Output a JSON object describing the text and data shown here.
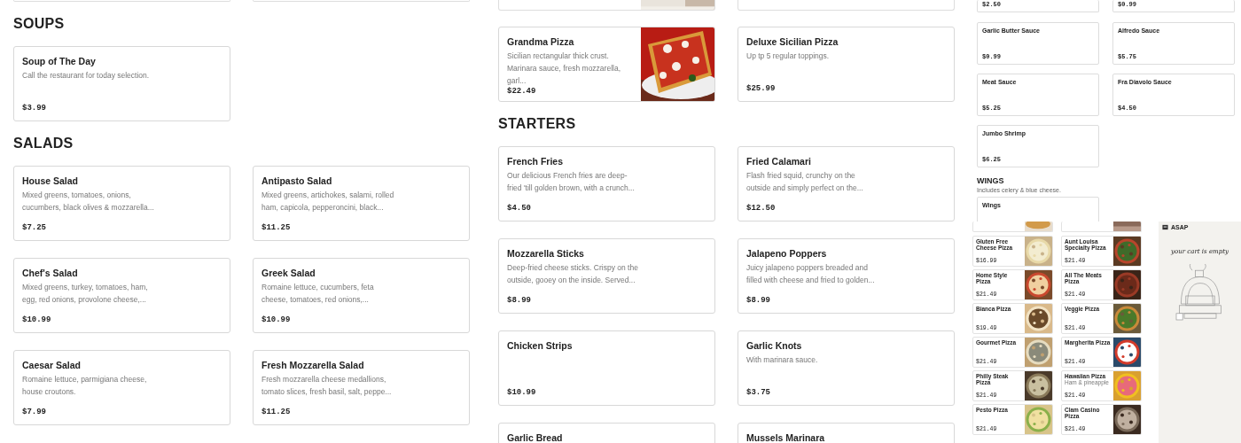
{
  "left": {
    "sections": [
      {
        "title": "SOUPS",
        "items": [
          {
            "name": "Soup of The Day",
            "description": "Call the restaurant for today selection.",
            "price": "$3.99"
          }
        ]
      },
      {
        "title": "SALADS",
        "items": [
          {
            "name": "House Salad",
            "description": "Mixed greens, tomatoes, onions, cucumbers, black olives & mozzarella...",
            "price": "$7.25"
          },
          {
            "name": "Antipasto Salad",
            "description": "Mixed greens, artichokes, salami, rolled ham, capicola, pepperoncini, black...",
            "price": "$11.25"
          },
          {
            "name": "Chef's Salad",
            "description": "Mixed greens, turkey, tomatoes, ham, egg, red onions, provolone cheese,...",
            "price": "$10.99"
          },
          {
            "name": "Greek Salad",
            "description": "Romaine lettuce, cucumbers, feta cheese, tomatoes, red onions,...",
            "price": "$10.99"
          },
          {
            "name": "Caesar Salad",
            "description": "Romaine lettuce, parmigiana cheese, house croutons.",
            "price": "$7.99"
          },
          {
            "name": "Fresh Mozzarella Salad",
            "description": "Fresh mozzarella cheese medallions, tomato slices, fresh basil, salt, peppe...",
            "price": "$11.25"
          }
        ]
      }
    ]
  },
  "middle": {
    "top_items": [
      {
        "name": "Grandma Pizza",
        "description": "Sicilian rectangular thick crust. Marinara sauce, fresh mozzarella, garl...",
        "price": "$22.49",
        "picture": true
      },
      {
        "name": "Deluxe Sicilian Pizza",
        "description": "Up tp 5 regular toppings.",
        "price": "$25.99",
        "picture": false
      }
    ],
    "sections": [
      {
        "title": "STARTERS",
        "items": [
          {
            "name": "French Fries",
            "description": "Our delicious French fries are deep-fried 'till golden brown, with a crunch...",
            "price": "$4.50"
          },
          {
            "name": "Fried Calamari",
            "description": "Flash fried squid, crunchy on the outside and simply perfect on the...",
            "price": "$12.50"
          },
          {
            "name": "Mozzarella Sticks",
            "description": "Deep-fried cheese sticks. Crispy on the outside, gooey on the inside. Served...",
            "price": "$8.99"
          },
          {
            "name": "Jalapeno Poppers",
            "description": "Juicy jalapeno poppers breaded and filled with cheese and fried to golden...",
            "price": "$8.99"
          },
          {
            "name": "Chicken Strips",
            "price": "$10.99"
          },
          {
            "name": "Garlic Knots",
            "description": "With marinara sauce.",
            "price": "$3.75"
          },
          {
            "name": "Garlic Bread"
          },
          {
            "name": "Mussels Marinara"
          }
        ]
      }
    ]
  },
  "sauces": {
    "cut_prices": [
      "$2.50",
      "$0.99"
    ],
    "items": [
      {
        "name": "Garlic Butter Sauce",
        "price": "$0.99"
      },
      {
        "name": "Alfredo Sauce",
        "price": "$5.75"
      },
      {
        "name": "Meat Sauce",
        "price": "$5.25"
      },
      {
        "name": "Fra Diavolo Sauce",
        "price": "$4.50"
      },
      {
        "name": "Jumbo Shrimp",
        "price": "$6.25"
      }
    ],
    "wings": {
      "title": "WINGS",
      "description": "Includes celery & blue cheese.",
      "item": "Wings"
    }
  },
  "pizzas": {
    "items": [
      {
        "name": "Gluten Free Cheese Pizza",
        "price": "$16.99"
      },
      {
        "name": "Aunt Louisa Specialty Pizza",
        "price": "$21.49"
      },
      {
        "name": "Home Style Pizza",
        "price": "$21.49"
      },
      {
        "name": "All The Meats Pizza",
        "price": "$21.49"
      },
      {
        "name": "Bianca Pizza",
        "price": "$19.49"
      },
      {
        "name": "Veggie Pizza",
        "price": "$21.49"
      },
      {
        "name": "Gourmet Pizza",
        "price": "$21.49"
      },
      {
        "name": "Margherita Pizza",
        "price": "$21.49"
      },
      {
        "name": "Philly Steak Pizza",
        "price": "$21.49"
      },
      {
        "name": "Hawaiian Pizza",
        "description": "Ham & pineapple",
        "price": "$21.49"
      },
      {
        "name": "Pesto Pizza",
        "price": "$21.49"
      },
      {
        "name": "Clam Casino Pizza",
        "price": "$21.49"
      }
    ]
  },
  "cart": {
    "title": "ASAP",
    "message": "your cart is empty"
  }
}
